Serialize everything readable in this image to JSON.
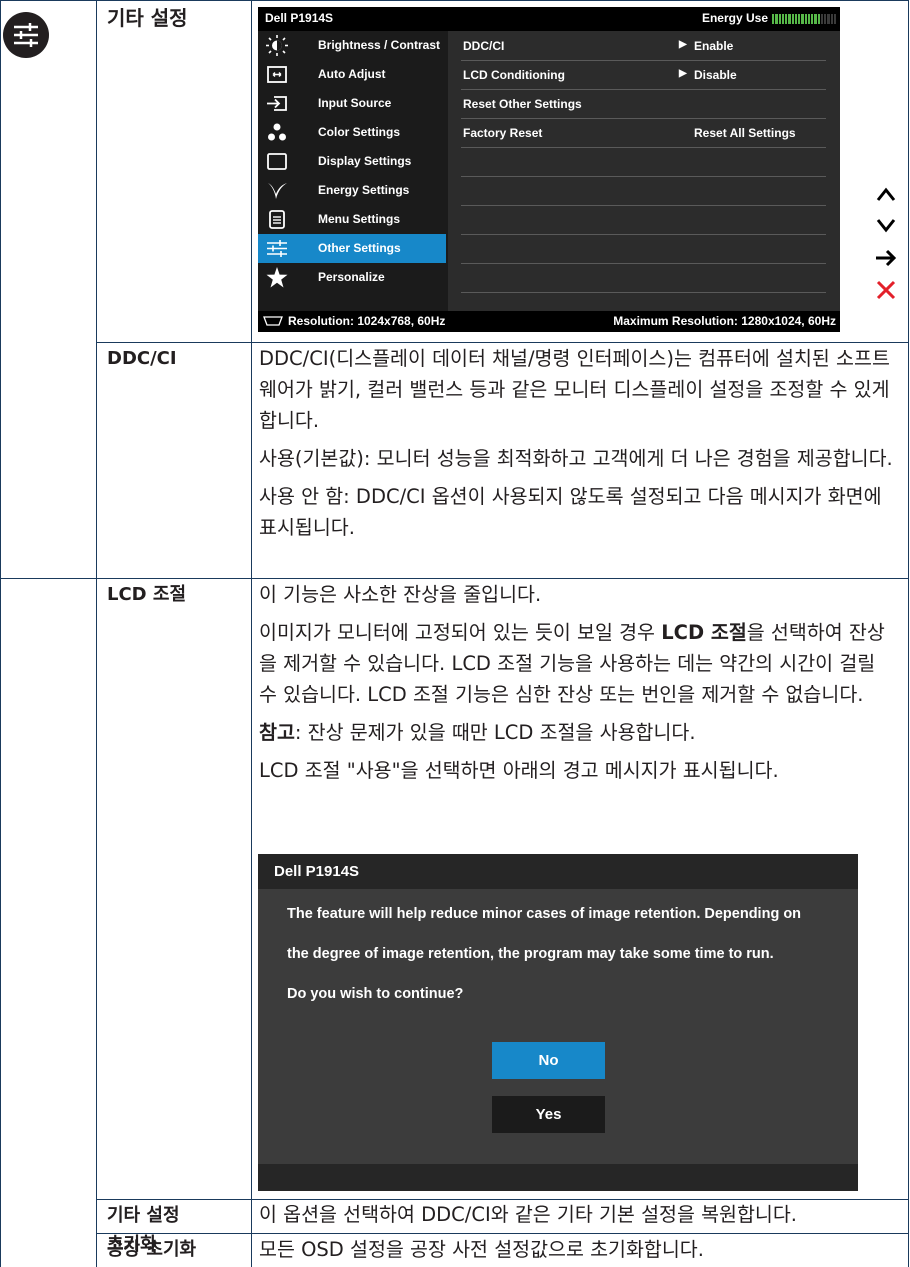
{
  "section_title": "기타 설정",
  "osd": {
    "model": "Dell P1914S",
    "energy_label": "Energy Use",
    "energy_level": 0.75,
    "menu": [
      {
        "label": "Brightness / Contrast",
        "icon": "brightness-icon"
      },
      {
        "label": "Auto Adjust",
        "icon": "auto-adjust-icon"
      },
      {
        "label": "Input Source",
        "icon": "input-source-icon"
      },
      {
        "label": "Color Settings",
        "icon": "color-settings-icon"
      },
      {
        "label": "Display Settings",
        "icon": "display-settings-icon"
      },
      {
        "label": "Energy Settings",
        "icon": "energy-settings-icon"
      },
      {
        "label": "Menu Settings",
        "icon": "menu-settings-icon"
      },
      {
        "label": "Other Settings",
        "icon": "other-settings-icon"
      },
      {
        "label": "Personalize",
        "icon": "star-icon"
      }
    ],
    "selected": "Other Settings",
    "options": [
      {
        "name": "DDC/CI",
        "arrow": "▶",
        "value": "Enable"
      },
      {
        "name": "LCD Conditioning",
        "arrow": "▶",
        "value": "Disable"
      },
      {
        "name": "Reset Other Settings",
        "arrow": "",
        "value": ""
      },
      {
        "name": "Factory Reset",
        "arrow": "",
        "value": "Reset All Settings"
      }
    ],
    "resolution": "Resolution: 1024x768,  60Hz",
    "max_resolution": "Maximum Resolution: 1280x1024,  60Hz"
  },
  "nav_buttons": [
    "up-icon",
    "down-icon",
    "right-arrow-icon",
    "close-icon"
  ],
  "accent_blue": "#1788c9",
  "nav_close_color": "#e3202a",
  "rows": {
    "ddcci": {
      "label": "DDC/CI",
      "p1": "DDC/CI(디스플레이 데이터 채널/명령 인터페이스)는 컴퓨터에 설치된 소프트웨어가 밝기, 컬러 밸런스 등과 같은 모니터 디스플레이 설정을 조정할 수 있게 합니다.",
      "p2": "사용(기본값): 모니터 성능을 최적화하고 고객에게 더 나은 경험을 제공합니다.",
      "p3": "사용 안 함: DDC/CI 옵션이 사용되지 않도록 설정되고 다음 메시지가 화면에 표시됩니다."
    },
    "lcd": {
      "label": "LCD 조절",
      "p1": "이 기능은 사소한 잔상을 줄입니다.",
      "p2_a": "이미지가 모니터에 고정되어 있는 듯이 보일 경우 ",
      "p2_b": "LCD 조절",
      "p2_c": "을 선택하여 잔상을 제거할 수 있습니다. LCD 조절 기능을 사용하는 데는 약간의 시간이 걸릴 수 있습니다. LCD 조절 기능은 심한 잔상 또는 번인을 제거할 수 없습니다.",
      "note_label": "참고",
      "note_text": ": 잔상 문제가 있을 때만 LCD 조절을 사용합니다.",
      "p4": "LCD 조절 \"사용\"을 선택하면 아래의 경고 메시지가 표시됩니다."
    },
    "reset_other": {
      "label_1": "기타 설정",
      "label_2": "초기화",
      "text": "이 옵션을 선택하여 DDC/CI와 같은 기타 기본 설정을 복원합니다."
    },
    "factory": {
      "label": "공장 초기화",
      "text": "모든 OSD 설정을 공장 사전 설정값으로 초기화합니다."
    }
  },
  "dialog": {
    "title": "Dell P1914S",
    "line1": "The feature will help reduce minor cases of image retention. Depending on",
    "line2": "the degree of image retention, the program may take some time to run.",
    "line3": "Do you wish to continue?",
    "no_label": "No",
    "yes_label": "Yes"
  }
}
